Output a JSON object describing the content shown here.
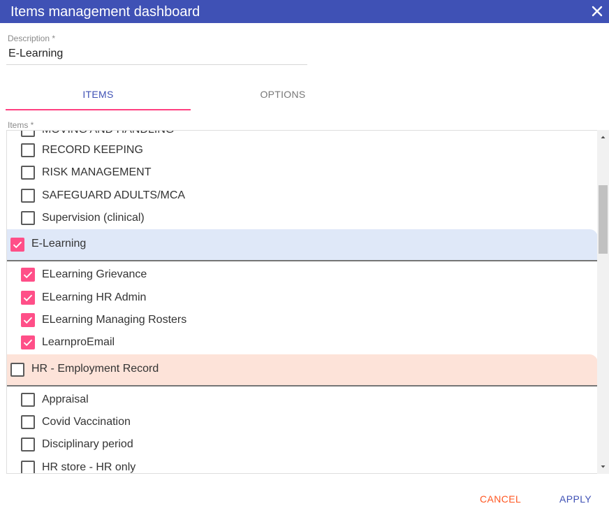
{
  "dialog": {
    "title": "Items management dashboard",
    "header_color": "#3f51b5",
    "close_icon": "close-icon"
  },
  "description": {
    "label": "Description *",
    "value": "E-Learning"
  },
  "tabs": [
    {
      "label": "ITEMS",
      "active": true
    },
    {
      "label": "OPTIONS",
      "active": false
    }
  ],
  "items_field": {
    "label": "Items *",
    "rows": [
      {
        "label": "MOVING AND HANDLING",
        "checked": false
      },
      {
        "label": "RECORD KEEPING",
        "checked": false
      },
      {
        "label": "RISK MANAGEMENT",
        "checked": false
      },
      {
        "label": "SAFEGUARD ADULTS/MCA",
        "checked": false
      },
      {
        "label": "Supervision (clinical)",
        "checked": false
      }
    ],
    "group_elearning": {
      "label": "E-Learning",
      "checked": true,
      "color": "#dfe8f8",
      "rows": [
        {
          "label": "ELearning Grievance",
          "checked": true
        },
        {
          "label": "ELearning HR Admin",
          "checked": true
        },
        {
          "label": "ELearning Managing Rosters",
          "checked": true
        },
        {
          "label": "LearnproEmail",
          "checked": true
        }
      ]
    },
    "group_hr": {
      "label": "HR - Employment Record",
      "checked": false,
      "color": "#fde3d9",
      "rows": [
        {
          "label": "Appraisal",
          "checked": false
        },
        {
          "label": "Covid Vaccination",
          "checked": false
        },
        {
          "label": "Disciplinary period",
          "checked": false
        },
        {
          "label": "HR store - HR only",
          "checked": false
        }
      ]
    },
    "checkbox_color": "#ff4f88"
  },
  "footer": {
    "cancel_label": "CANCEL",
    "apply_label": "APPLY"
  }
}
